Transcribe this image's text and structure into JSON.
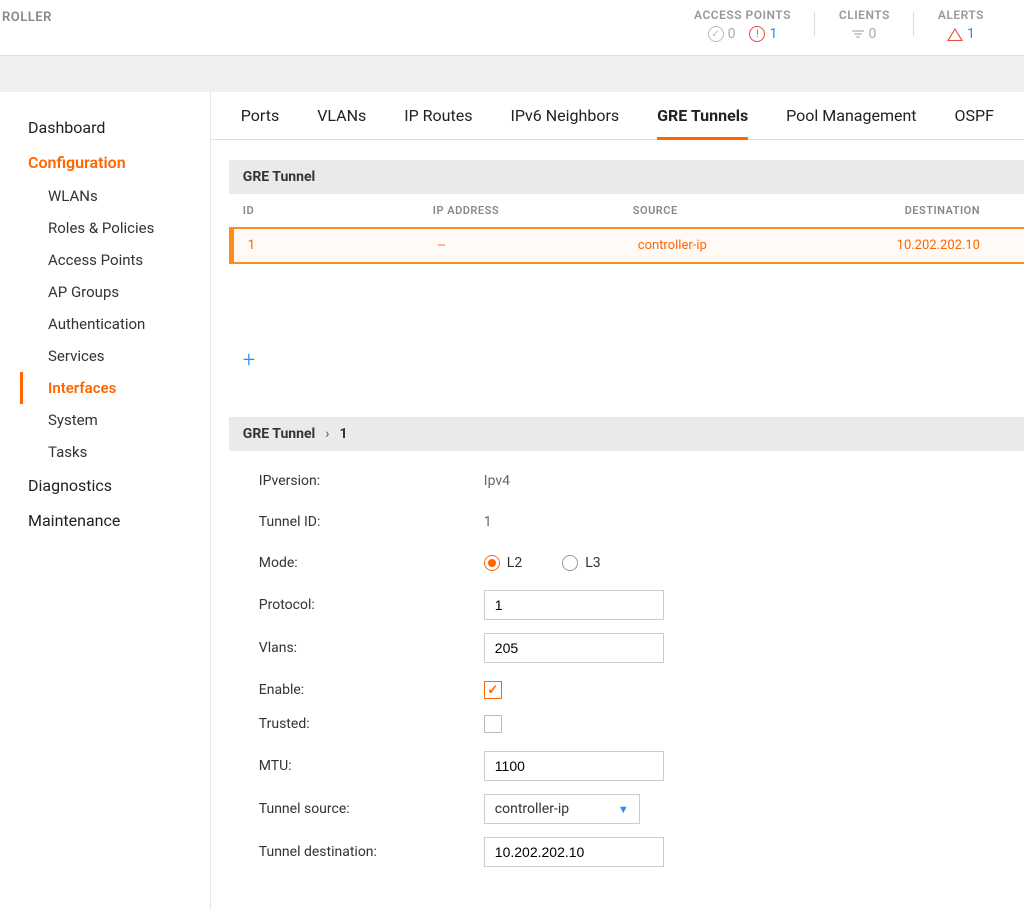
{
  "topbar": {
    "title_fragment": "ROLLER",
    "stats": {
      "access_points": {
        "label": "ACCESS POINTS",
        "ok": "0",
        "warn": "1"
      },
      "clients": {
        "label": "CLIENTS",
        "count": "0"
      },
      "alerts": {
        "label": "ALERTS",
        "count": "1"
      }
    }
  },
  "sidebar": {
    "dashboard": "Dashboard",
    "configuration": "Configuration",
    "subitems": {
      "wlans": "WLANs",
      "roles": "Roles & Policies",
      "aps": "Access Points",
      "apgroups": "AP Groups",
      "auth": "Authentication",
      "services": "Services",
      "interfaces": "Interfaces",
      "system": "System",
      "tasks": "Tasks"
    },
    "diagnostics": "Diagnostics",
    "maintenance": "Maintenance"
  },
  "tabs": {
    "ports": "Ports",
    "vlans": "VLANs",
    "iproutes": "IP Routes",
    "ipv6": "IPv6 Neighbors",
    "gre": "GRE Tunnels",
    "pool": "Pool Management",
    "ospf": "OSPF"
  },
  "table": {
    "title": "GRE Tunnel",
    "headers": {
      "id": "ID",
      "ip": "IP ADDRESS",
      "src": "SOURCE",
      "dst": "DESTINATION"
    },
    "row": {
      "id": "1",
      "ip": "--",
      "src": "controller-ip",
      "dst": "10.202.202.10"
    }
  },
  "detail": {
    "crumb1": "GRE Tunnel",
    "crumb2": "1",
    "fields": {
      "ipversion_label": "IPversion:",
      "ipversion_value": "Ipv4",
      "tunnelid_label": "Tunnel ID:",
      "tunnelid_value": "1",
      "mode_label": "Mode:",
      "mode_l2": "L2",
      "mode_l3": "L3",
      "protocol_label": "Protocol:",
      "protocol_value": "1",
      "vlans_label": "Vlans:",
      "vlans_value": "205",
      "enable_label": "Enable:",
      "trusted_label": "Trusted:",
      "mtu_label": "MTU:",
      "mtu_value": "1100",
      "src_label": "Tunnel source:",
      "src_value": "controller-ip",
      "dst_label": "Tunnel destination:",
      "dst_value": "10.202.202.10"
    }
  }
}
